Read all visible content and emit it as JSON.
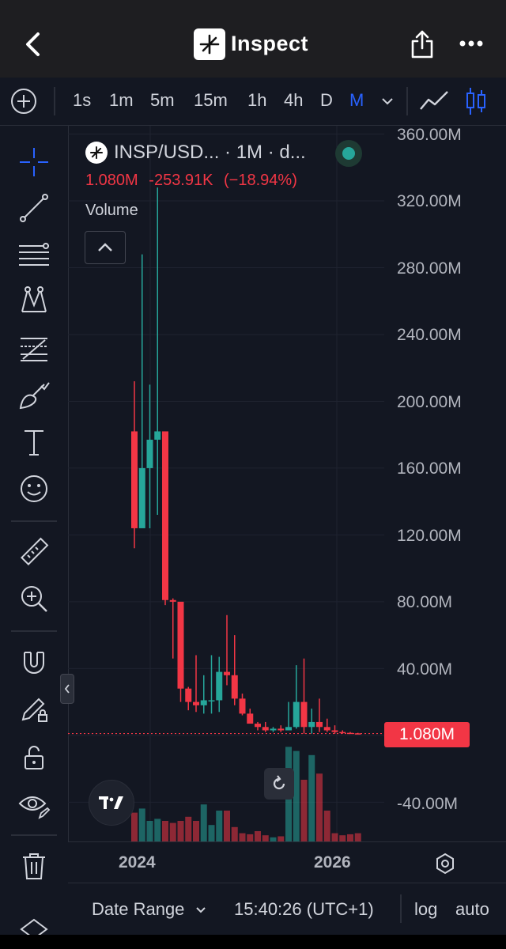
{
  "header": {
    "title": "Inspect",
    "icons": [
      "back-icon",
      "asterisk-logo-icon",
      "share-icon",
      "more-icon"
    ]
  },
  "timeframes": {
    "items": [
      "1s",
      "1m",
      "5m",
      "15m",
      "1h",
      "4h",
      "D",
      "M"
    ],
    "selected": "M"
  },
  "legend": {
    "symbol": "INSP/USD... · 1M · d...",
    "last_value": "1.080M",
    "change": "-253.91K",
    "change_pct": "(−18.94%)",
    "volume_label": "Volume"
  },
  "price_axis": {
    "labels": [
      "360.00M",
      "320.00M",
      "280.00M",
      "240.00M",
      "200.00M",
      "160.00M",
      "120.00M",
      "80.00M",
      "40.00M",
      "-40.00M"
    ],
    "current_price_tag": "1.080M"
  },
  "time_axis": {
    "labels": [
      "2024",
      "2026"
    ]
  },
  "bottom_bar": {
    "date_range": "Date Range",
    "time": "15:40:26 (UTC+1)",
    "log": "log",
    "auto": "auto"
  },
  "colors": {
    "up": "#26a69a",
    "down": "#f23645",
    "accent": "#2962ff",
    "background": "#131722"
  },
  "chart_data": {
    "type": "candlestick",
    "title": "INSP/USD... · 1M · d...",
    "ylim": [
      -60,
      360
    ],
    "y_unit": "M",
    "candles": [
      {
        "open": 182,
        "high": 212,
        "low": 112,
        "close": 124
      },
      {
        "open": 124,
        "high": 288,
        "low": 133,
        "close": 160
      },
      {
        "open": 160,
        "high": 210,
        "low": 124,
        "close": 177
      },
      {
        "open": 177,
        "high": 328,
        "low": 132,
        "close": 182
      },
      {
        "open": 182,
        "high": 182,
        "low": 78,
        "close": 81
      },
      {
        "open": 81,
        "high": 82,
        "low": 46,
        "close": 80
      },
      {
        "open": 80,
        "high": 79,
        "low": 20,
        "close": 28
      },
      {
        "open": 28,
        "high": 29,
        "low": 15,
        "close": 20
      },
      {
        "open": 20,
        "high": 48,
        "low": 14,
        "close": 18
      },
      {
        "open": 18,
        "high": 36,
        "low": 13,
        "close": 21
      },
      {
        "open": 21,
        "high": 48,
        "low": 13,
        "close": 21
      },
      {
        "open": 21,
        "high": 47,
        "low": 14,
        "close": 38
      },
      {
        "open": 38,
        "high": 72,
        "low": 30,
        "close": 36
      },
      {
        "open": 36,
        "high": 60,
        "low": 18,
        "close": 22
      },
      {
        "open": 22,
        "high": 25,
        "low": 12,
        "close": 13
      },
      {
        "open": 13,
        "high": 16,
        "low": 8,
        "close": 7
      },
      {
        "open": 7,
        "high": 8,
        "low": 3,
        "close": 5
      },
      {
        "open": 5,
        "high": 8,
        "low": 2,
        "close": 3
      },
      {
        "open": 3,
        "high": 5,
        "low": 2,
        "close": 4
      },
      {
        "open": 4,
        "high": 6,
        "low": 2,
        "close": 3
      },
      {
        "open": 3,
        "high": 20,
        "low": 3,
        "close": 5
      },
      {
        "open": 5,
        "high": 42,
        "low": 4,
        "close": 20
      },
      {
        "open": 20,
        "high": 46,
        "low": 1,
        "close": 5
      },
      {
        "open": 5,
        "high": 16,
        "low": 1,
        "close": 8
      },
      {
        "open": 8,
        "high": 22,
        "low": 2,
        "close": 5
      },
      {
        "open": 5,
        "high": 10,
        "low": 2,
        "close": 3
      },
      {
        "open": 3,
        "high": 6,
        "low": 1,
        "close": 2
      },
      {
        "open": 2,
        "high": 3,
        "low": 1,
        "close": 1.5
      },
      {
        "open": 1.5,
        "high": 2,
        "low": 1,
        "close": 1.2
      },
      {
        "open": 1.2,
        "high": 1.5,
        "low": 1,
        "close": 1.08
      }
    ],
    "volume": [
      28,
      32,
      20,
      22,
      20,
      18,
      20,
      24,
      20,
      36,
      16,
      30,
      30,
      14,
      8,
      7,
      10,
      6,
      4,
      5,
      92,
      88,
      60,
      84,
      66,
      30,
      8,
      6,
      7,
      8
    ],
    "current_price": 1.08
  }
}
